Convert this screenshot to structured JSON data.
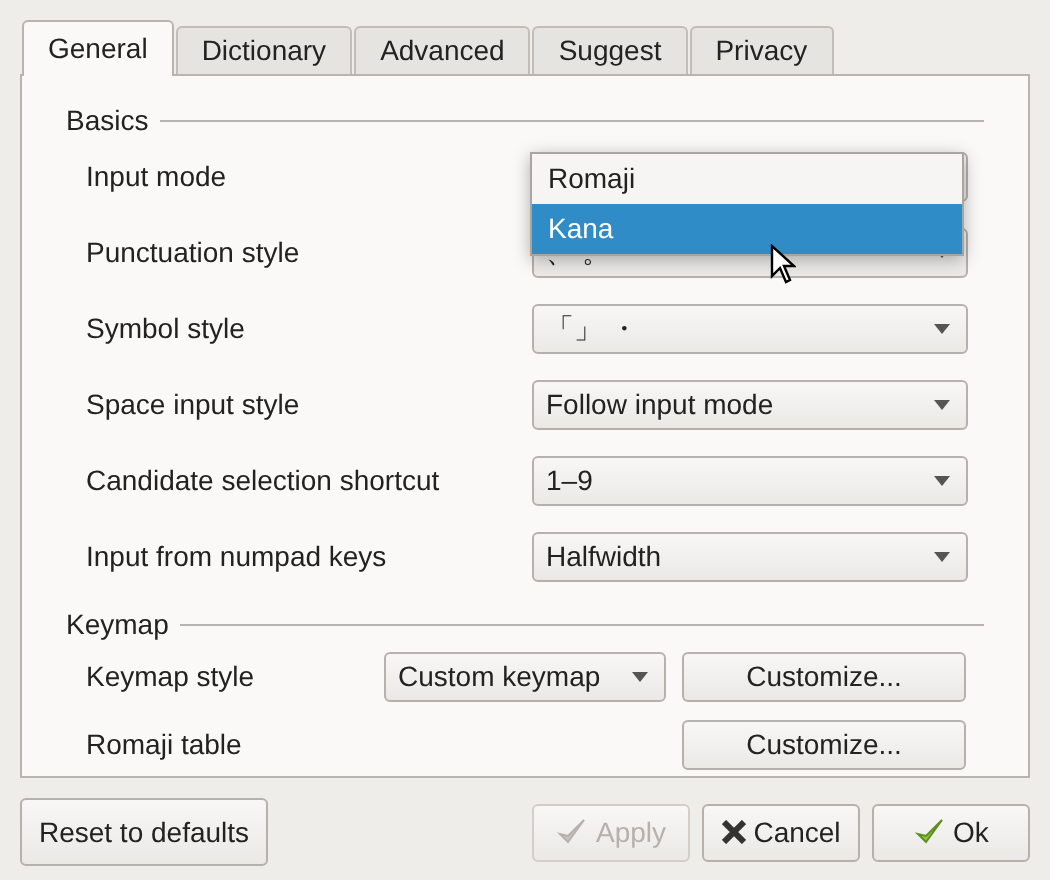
{
  "tabs": [
    {
      "label": "General",
      "selected": true
    },
    {
      "label": "Dictionary",
      "selected": false
    },
    {
      "label": "Advanced",
      "selected": false
    },
    {
      "label": "Suggest",
      "selected": false
    },
    {
      "label": "Privacy",
      "selected": false
    }
  ],
  "sections": [
    {
      "title": "Basics",
      "rows": [
        {
          "kind": "combo",
          "label": "Input mode",
          "value": ""
        },
        {
          "kind": "combo",
          "label": "Punctuation style",
          "value": "、 。"
        },
        {
          "kind": "combo",
          "label": "Symbol style",
          "value": "「」 ・"
        },
        {
          "kind": "combo",
          "label": "Space input style",
          "value": "Follow input mode"
        },
        {
          "kind": "combo",
          "label": "Candidate selection shortcut",
          "value": "1–9"
        },
        {
          "kind": "combo",
          "label": "Input from numpad keys",
          "value": "Halfwidth"
        }
      ]
    },
    {
      "title": "Keymap",
      "rows": [
        {
          "kind": "combo_button",
          "label": "Keymap style",
          "value": "Custom keymap",
          "button": "Customize..."
        },
        {
          "kind": "button",
          "label": "Romaji table",
          "button": "Customize..."
        }
      ]
    }
  ],
  "popup": {
    "items": [
      {
        "label": "Romaji",
        "selected": false
      },
      {
        "label": "Kana",
        "selected": true
      }
    ]
  },
  "buttons": [
    {
      "kind": "reset",
      "label": "Reset to defaults",
      "disabled": false
    },
    {
      "kind": "apply",
      "label": "Apply",
      "disabled": true
    },
    {
      "kind": "cancel",
      "label": "Cancel",
      "disabled": false
    },
    {
      "kind": "ok",
      "label": "Ok",
      "disabled": false
    }
  ]
}
